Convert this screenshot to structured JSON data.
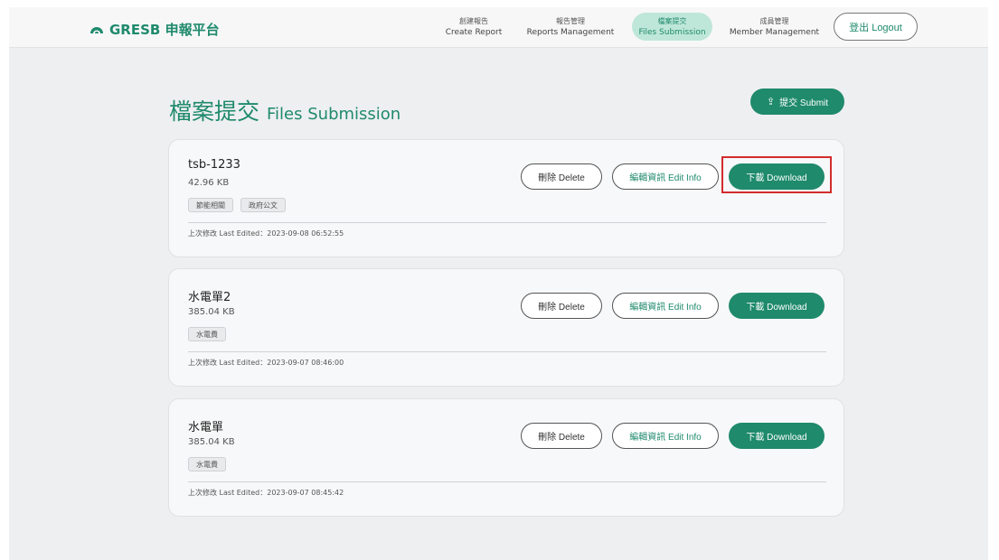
{
  "brand": {
    "name": "GRESB 申報平台",
    "icon": "cloud-icon"
  },
  "nav": {
    "items": [
      {
        "zh": "創建報告",
        "en": "Create Report",
        "active": false
      },
      {
        "zh": "報告管理",
        "en": "Reports Management",
        "active": false
      },
      {
        "zh": "檔案提交",
        "en": "Files Submission",
        "active": true
      },
      {
        "zh": "成員管理",
        "en": "Member Management",
        "active": false
      }
    ],
    "logout": "登出 Logout"
  },
  "page": {
    "title_zh": "檔案提交",
    "title_en": "Files Submission",
    "submit_icon": "upload-icon",
    "submit_label": "提交 Submit"
  },
  "buttons": {
    "delete": "刪除 Delete",
    "edit": "編輯資訊 Edit Info",
    "download": "下載 Download"
  },
  "files": [
    {
      "name": "tsb-1233",
      "size": "42.96 KB",
      "tags": [
        "節能相關",
        "政府公文"
      ],
      "last_edited": "上次修改 Last Edited：2023-09-08 06:52:55"
    },
    {
      "name": "水電單2",
      "size": "385.04 KB",
      "tags": [
        "水電費"
      ],
      "last_edited": "上次修改 Last Edited：2023-09-07 08:46:00"
    },
    {
      "name": "水電單",
      "size": "385.04 KB",
      "tags": [
        "水電費"
      ],
      "last_edited": "上次修改 Last Edited：2023-09-07 08:45:42"
    }
  ],
  "colors": {
    "accent": "#1f8a6c",
    "highlight": "#d22c2c"
  }
}
